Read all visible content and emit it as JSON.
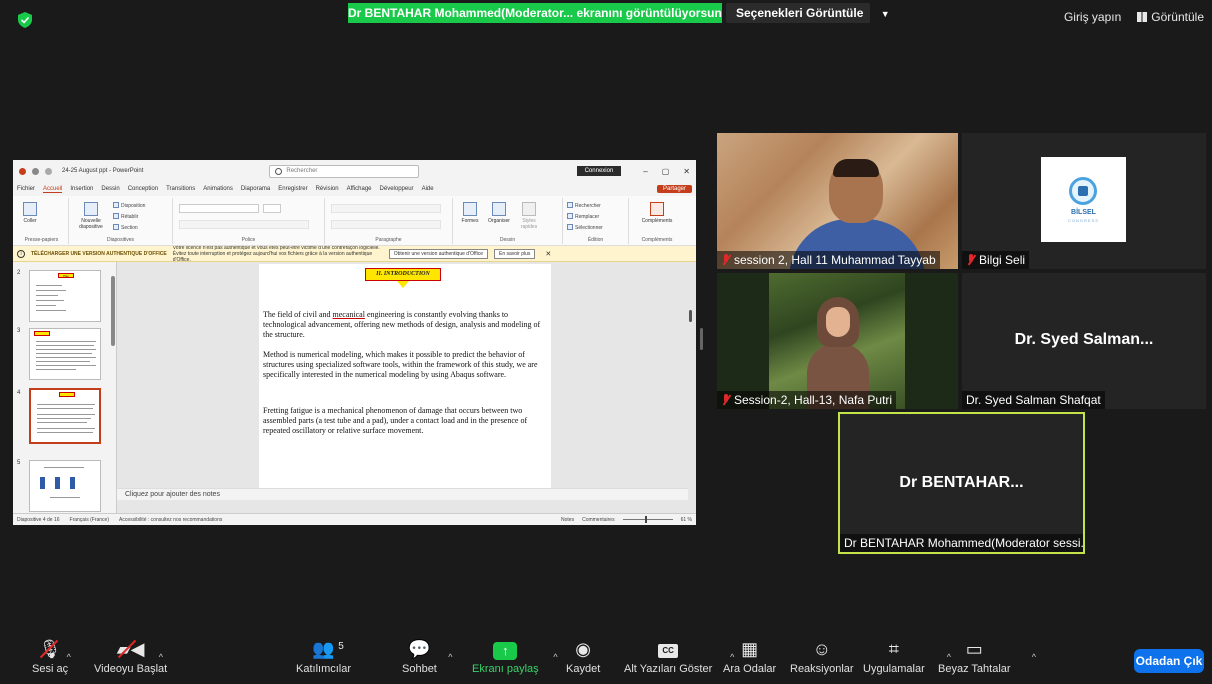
{
  "banner": {
    "sharing_text": "Dr BENTAHAR Mohammed(Moderator... ekranını görüntülüyorsunuz",
    "view_options": "Seçenekleri Görüntüle"
  },
  "top_right": {
    "login": "Giriş yapın",
    "view": "Görüntüle"
  },
  "ppt": {
    "doc_title": "24-25 August ppt - PowerPoint",
    "search_placeholder": "Rechercher",
    "connexion": "Connexion",
    "menu": [
      "Fichier",
      "Accueil",
      "Insertion",
      "Dessin",
      "Conception",
      "Transitions",
      "Animations",
      "Diaporama",
      "Enregistrer",
      "Révision",
      "Affichage",
      "Développeur",
      "Aide"
    ],
    "share": "Partager",
    "ribbon": {
      "paste": "Coller",
      "new_slide": "Nouvelle diapositive",
      "layout": "Disposition",
      "reset": "Rétablir",
      "section": "Section",
      "shapes": "Formes",
      "arrange": "Organiser",
      "quick_styles": "Styles rapides",
      "find": "Rechercher",
      "replace": "Remplacer",
      "select": "Sélectionner",
      "addins": "Compléments",
      "groups": [
        "Presse-papiers",
        "Diapositives",
        "Police",
        "Paragraphe",
        "Dessin",
        "Édition",
        "Compléments"
      ]
    },
    "warning": {
      "title": "TÉLÉCHARGER UNE VERSION AUTHENTIQUE D'OFFICE",
      "message": "Votre licence n'est pas authentique et vous êtes peut-être victime d'une contrefaçon logicielle. Évitez toute interruption et protégez aujourd'hui vos fichiers grâce à la version authentique d'Office.",
      "get_button": "Obtenir une version authentique d'Office",
      "learn_more": "En savoir plus"
    },
    "thumbnails": [
      "2",
      "3",
      "4",
      "5"
    ],
    "thumb2_title": "Plan",
    "slide": {
      "title": "II. INTRODUCTION",
      "p1_a": "The field of civil and ",
      "p1_u": "mecanical",
      "p1_b": " engineering is constantly evolving thanks to technological advancement, offering new methods of design, analysis and modeling of the structure.",
      "p2": "Method is numerical modeling, which makes it possible to predict the behavior of structures using specialized software tools, within the framework of this study, we are specifically interested in the numerical modeling by using Abaqus software.",
      "p3": "Fretting fatigue is a mechanical phenomenon of damage that occurs between two assembled parts (a test tube and a pad), under a contact load and in the presence of repeated oscillatory or relative surface movement."
    },
    "notes_placeholder": "Cliquez pour ajouter des notes",
    "status": {
      "slide_info": "Diapositive 4 de 16",
      "language": "Français (France)",
      "accessibility": "Accessibilité : consultez nos recommandations",
      "notes": "Notes",
      "comments": "Commentaires",
      "zoom": "61 %"
    }
  },
  "participants": [
    {
      "name": "session 2, Hall 11 Muhammad Tayyab"
    },
    {
      "name": "Bilgi Seli",
      "logo_text": "BİLSEL",
      "logo_sub": "CONGRESS"
    },
    {
      "name": "Session-2, Hall-13, Nafa Putri"
    },
    {
      "name": "Dr. Syed Salman Shafqat",
      "display": "Dr. Syed Salman..."
    },
    {
      "name": "Dr BENTAHAR Mohammed(Moderator sessi...",
      "display": "Dr  BENTAHAR..."
    }
  ],
  "toolbar": {
    "audio": "Sesi aç",
    "video": "Videoyu Başlat",
    "participants": "Katılımcılar",
    "participants_count": "5",
    "chat": "Sohbet",
    "share": "Ekranı paylaş",
    "record": "Kaydet",
    "captions": "Alt Yazıları Göster",
    "captions_icon": "CC",
    "breakout": "Ara Odalar",
    "reactions": "Reaksiyonlar",
    "apps": "Uygulamalar",
    "whiteboard": "Beyaz Tahtalar",
    "leave": "Odadan Çık"
  },
  "colors": {
    "share_green": "#19c94a",
    "active_speaker_border": "#c4e34a",
    "leave_blue": "#0e72ed",
    "ppt_accent": "#c43e1c"
  },
  "icons": [
    "shield-icon",
    "mic-muted-icon",
    "video-off-icon",
    "participants-icon",
    "chat-icon",
    "share-screen-icon",
    "record-icon",
    "cc-icon",
    "breakout-icon",
    "reaction-icon",
    "apps-icon",
    "whiteboard-icon"
  ]
}
